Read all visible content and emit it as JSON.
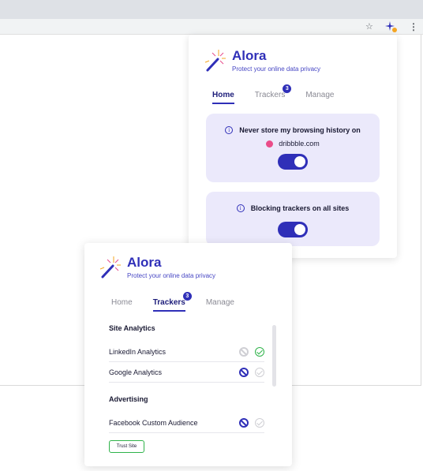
{
  "brand": {
    "name": "Alora",
    "tagline": "Protect your online data privacy"
  },
  "tabs": {
    "home": "Home",
    "trackers": "Trackers",
    "trackers_badge": "3",
    "manage": "Manage"
  },
  "home": {
    "history_card": {
      "title": "Never store my browsing history on",
      "site": "dribbble.com",
      "toggle_on": true
    },
    "blocking_card": {
      "title": "Blocking trackers on all sites",
      "toggle_on": true
    }
  },
  "trackers": {
    "sections": [
      {
        "heading": "Site Analytics",
        "items": [
          {
            "name": "LinkedIn Analytics",
            "blocked": false,
            "allowed": true
          },
          {
            "name": "Google Analytics",
            "blocked": true,
            "allowed": false
          }
        ]
      },
      {
        "heading": "Advertising",
        "items": [
          {
            "name": "Facebook Custom Audience",
            "blocked": true,
            "allowed": false
          }
        ]
      }
    ],
    "trust_button": "Trust Site"
  },
  "colors": {
    "accent": "#2f2fb8",
    "card_bg": "#ebe9fb",
    "allowed": "#2fb34a",
    "dribbble": "#ea4c89"
  },
  "icons": {
    "toolbar": [
      "star-icon",
      "extension-icon",
      "menu-icon"
    ]
  }
}
